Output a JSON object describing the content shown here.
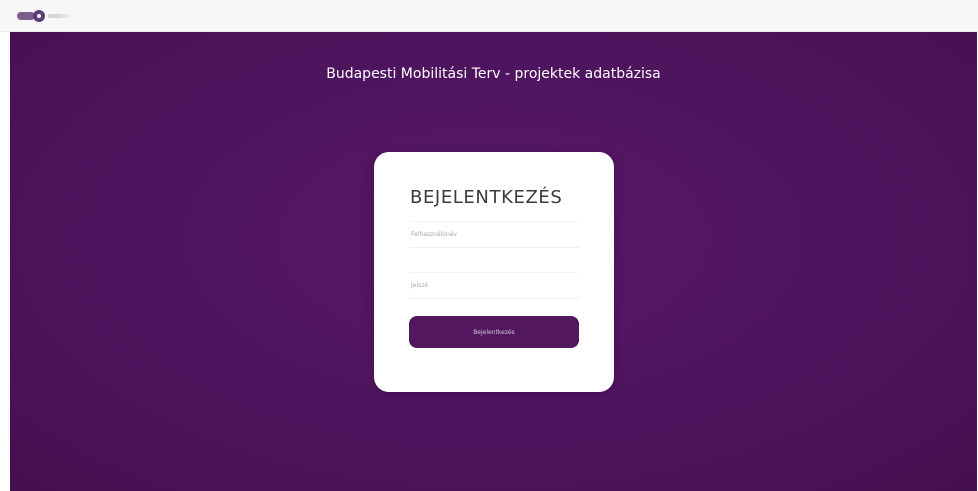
{
  "header": {
    "logo_icon": "bkk-logo-icon"
  },
  "page": {
    "title": "Budapesti Mobilitási Terv - projektek adatbázisa"
  },
  "login": {
    "heading": "BEJELENTKEZÉS",
    "username_placeholder": "Felhasználónév",
    "password_placeholder": "Jelszó",
    "submit_label": "Bejelentkezés"
  },
  "colors": {
    "primary_purple": "#52175f",
    "background_purple": "#4e145e",
    "card_background": "#ffffff"
  }
}
